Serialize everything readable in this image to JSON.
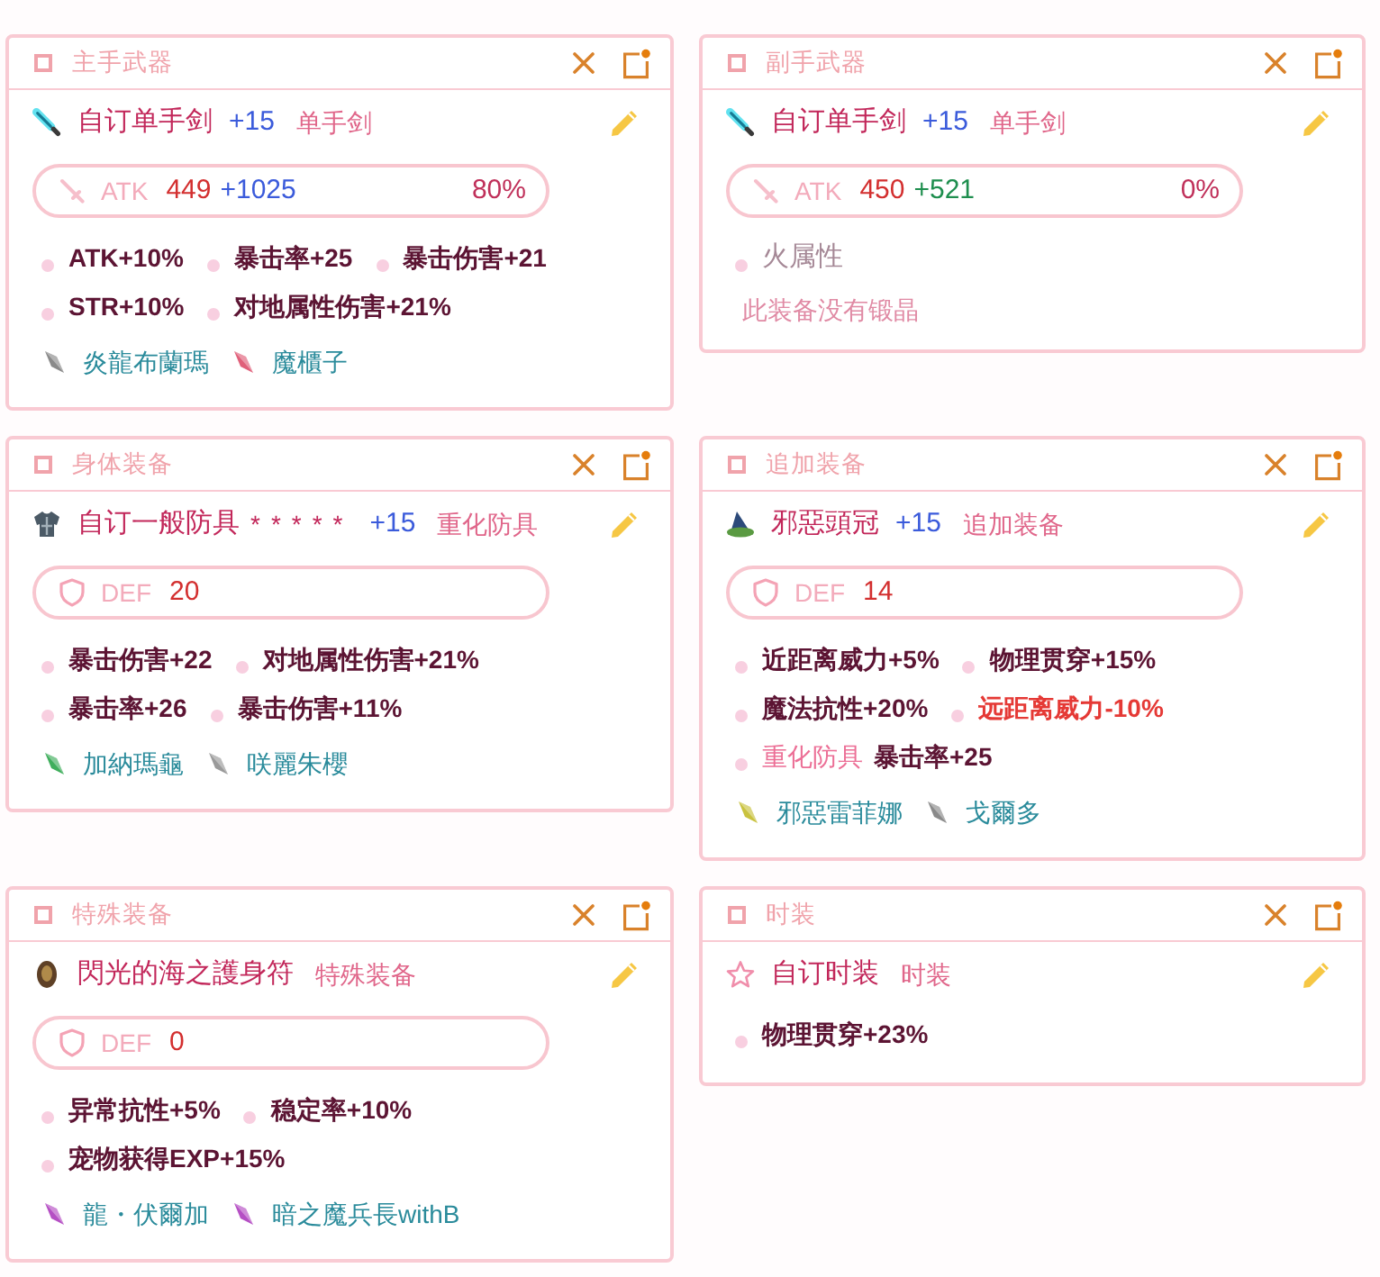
{
  "cards": [
    {
      "kind": "main_weapon",
      "title": "主手武器",
      "item": {
        "name": "自订单手剑",
        "refine": "+15",
        "type": "单手剑"
      },
      "stat_bar": {
        "label": "ATK",
        "base": "449",
        "bonus": "+1025",
        "percent": "80%"
      },
      "stats": [
        {
          "kind": "bonus",
          "text": "ATK+10%"
        },
        {
          "kind": "bonus",
          "text": "暴击率+25"
        },
        {
          "kind": "bonus",
          "text": "暴击伤害+21"
        },
        {
          "kind": "bonus",
          "text": "STR+10%"
        },
        {
          "kind": "bonus",
          "text": "对地属性伤害+21%"
        }
      ],
      "crystals": [
        {
          "name": "炎龍布蘭瑪",
          "color": "#8a8a8a"
        },
        {
          "name": "魔櫃子",
          "color": "#e0607a"
        }
      ]
    },
    {
      "kind": "sub_weapon",
      "title": "副手武器",
      "item": {
        "name": "自订单手剑",
        "refine": "+15",
        "type": "单手剑"
      },
      "stat_bar": {
        "label": "ATK",
        "base": "450",
        "bonus": "+521",
        "percent": "0%"
      },
      "stats": [
        {
          "kind": "element",
          "text": "火属性"
        }
      ],
      "empty_note": "此装备没有锻晶"
    },
    {
      "kind": "armor",
      "title": "身体装备",
      "item": {
        "name": "自订一般防具",
        "rank": "*****",
        "refine": "+15",
        "type": "重化防具"
      },
      "stat_bar": {
        "label": "DEF",
        "base": "20"
      },
      "stats": [
        {
          "kind": "bonus",
          "text": "暴击伤害+22"
        },
        {
          "kind": "bonus",
          "text": "对地属性伤害+21%"
        },
        {
          "kind": "bonus",
          "text": "暴击率+26"
        },
        {
          "kind": "bonus",
          "text": "暴击伤害+11%"
        }
      ],
      "crystals": [
        {
          "name": "加納瑪龜",
          "color": "#3fae5c"
        },
        {
          "name": "咲麗朱櫻",
          "color": "#9a9a9a"
        }
      ]
    },
    {
      "kind": "additional",
      "title": "追加装备",
      "item": {
        "name": "邪惡頭冠",
        "refine": "+15",
        "type": "追加装备"
      },
      "stat_bar": {
        "label": "DEF",
        "base": "14"
      },
      "stats": [
        {
          "kind": "bonus",
          "text": "近距离威力+5%"
        },
        {
          "kind": "bonus",
          "text": "物理贯穿+15%"
        },
        {
          "kind": "bonus",
          "text": "魔法抗性+20%"
        },
        {
          "kind": "penalty",
          "text": "远距离威力-10%"
        },
        {
          "kind": "conditional",
          "condition": "重化防具",
          "text": "暴击率+25"
        }
      ],
      "crystals": [
        {
          "name": "邪惡雷菲娜",
          "color": "#c9c23e"
        },
        {
          "name": "戈爾多",
          "color": "#8a8a8a"
        }
      ]
    },
    {
      "kind": "special",
      "title": "特殊装备",
      "item": {
        "name": "閃光的海之護身符",
        "type": "特殊装备"
      },
      "stat_bar": {
        "label": "DEF",
        "base": "0"
      },
      "stats": [
        {
          "kind": "bonus",
          "text": "异常抗性+5%"
        },
        {
          "kind": "bonus",
          "text": "稳定率+10%"
        },
        {
          "kind": "bonus",
          "text": "宠物获得EXP+15%"
        }
      ],
      "crystals": [
        {
          "name": "龍・伏爾加",
          "color": "#b54fc4"
        },
        {
          "name": "暗之魔兵長withB",
          "color": "#b54fc4"
        }
      ]
    },
    {
      "kind": "avatar",
      "title": "时装",
      "item": {
        "name": "自订时装",
        "type": "时装"
      },
      "stats": [
        {
          "kind": "bonus",
          "text": "物理贯穿+23%"
        }
      ]
    }
  ]
}
